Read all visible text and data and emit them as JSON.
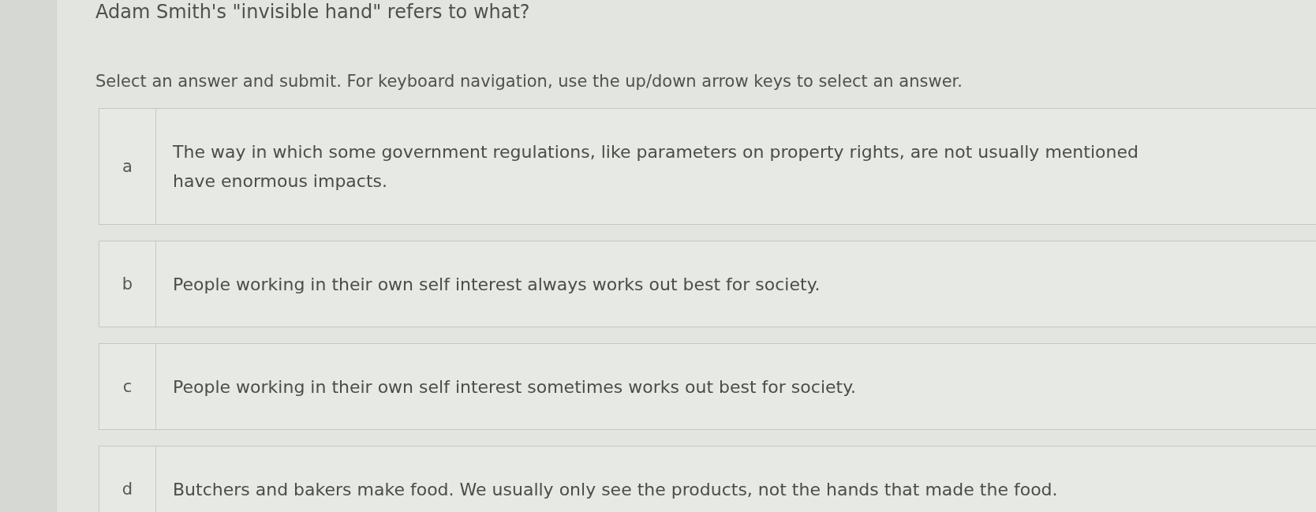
{
  "question": {
    "title": "Adam Smith's \"invisible hand\" refers to what?",
    "instructions": "Select an answer and submit. For keyboard navigation, use the up/down arrow keys to select an answer."
  },
  "options": [
    {
      "letter": "a",
      "lines": [
        "The way in which some government regulations, like parameters on property rights, are not usually mentioned",
        "have enormous impacts."
      ],
      "selected": false
    },
    {
      "letter": "b",
      "lines": [
        "People working in their own self interest always works out best for society."
      ],
      "selected": false
    },
    {
      "letter": "c",
      "lines": [
        "People working in their own self interest sometimes works out best for society."
      ],
      "selected": false
    },
    {
      "letter": "d",
      "lines": [
        "Butchers and bakers make food. We usually only see the products, not the hands that made the food."
      ],
      "selected": false
    }
  ]
}
